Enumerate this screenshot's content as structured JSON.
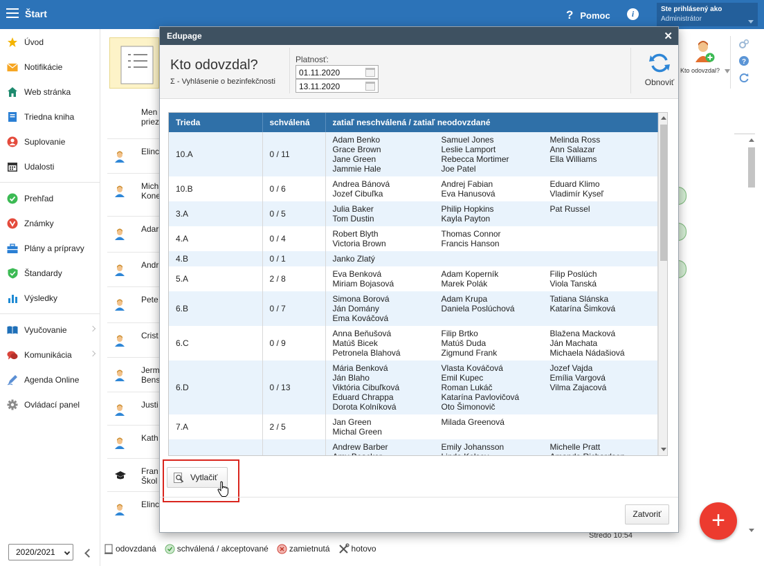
{
  "topbar": {
    "title": "Štart",
    "help_label": "Pomoc",
    "user_line1": "Ste prihlásený ako",
    "user_line2": "Administrátor"
  },
  "sidebar": {
    "items": [
      {
        "label": "Úvod",
        "icon": "star-icon"
      },
      {
        "label": "Notifikácie",
        "icon": "envelope-icon"
      },
      {
        "label": "Web stránka",
        "icon": "home-icon"
      },
      {
        "label": "Triedna kniha",
        "icon": "book-icon"
      },
      {
        "label": "Suplovanie",
        "icon": "person-icon"
      },
      {
        "label": "Udalosti",
        "icon": "calendar-icon"
      },
      {
        "label": "Prehľad",
        "icon": "check-circle-icon"
      },
      {
        "label": "Známky",
        "icon": "grades-icon"
      },
      {
        "label": "Plány a prípravy",
        "icon": "briefcase-icon"
      },
      {
        "label": "Štandardy",
        "icon": "shield-icon"
      },
      {
        "label": "Výsledky",
        "icon": "bar-chart-icon"
      },
      {
        "label": "Vyučovanie",
        "icon": "open-book-icon"
      },
      {
        "label": "Komunikácia",
        "icon": "chat-icon"
      },
      {
        "label": "Agenda Online",
        "icon": "pen-icon"
      },
      {
        "label": "Ovládací panel",
        "icon": "gear-icon"
      }
    ],
    "year": "2020/2021"
  },
  "background": {
    "col_head_l1": "Men",
    "col_head_l2": "priez",
    "rows": [
      {
        "l1": "Elinc",
        "l2": ""
      },
      {
        "l1": "Mich",
        "l2": "Kone"
      },
      {
        "l1": "Adar",
        "l2": ""
      },
      {
        "l1": "Andr",
        "l2": ""
      },
      {
        "l1": "Pete",
        "l2": ""
      },
      {
        "l1": "Crist",
        "l2": ""
      },
      {
        "l1": "Jerm",
        "l2": "Bens"
      },
      {
        "l1": "Justi",
        "l2": ""
      },
      {
        "l1": "Kath",
        "l2": ""
      },
      {
        "l1": "Fran",
        "l2": "Škol"
      },
      {
        "l1": "Elinc",
        "l2": ""
      }
    ],
    "toolbar_label": "Kto odovzdal?",
    "stredo_text": "Stredo 10:54"
  },
  "legend": [
    {
      "label": "odovzdaná",
      "icon": "document-icon"
    },
    {
      "label": "schválená / akceptované",
      "icon": "green-check-icon"
    },
    {
      "label": "zamietnutá",
      "icon": "red-x-icon"
    },
    {
      "label": "hotovo",
      "icon": "tools-icon"
    }
  ],
  "fab_label": "+",
  "modal": {
    "title": "Edupage",
    "heading": "Kto odovzdal?",
    "subtitle": "Σ - Vyhlásenie o bezinfekčnosti",
    "platnost_label": "Platnosť:",
    "date_from": "01.11.2020",
    "date_to": "13.11.2020",
    "refresh_label": "Obnoviť",
    "columns": [
      "Trieda",
      "schválená",
      "zatiaľ neschválená / zatiaľ neodovzdané"
    ],
    "rows": [
      {
        "trieda": "10.A",
        "count": "0 / 11",
        "names": [
          [
            "Adam Benko",
            "Grace Brown",
            "Jane Green",
            "Jammie Hale"
          ],
          [
            "Samuel Jones",
            "Leslie Lamport",
            "Rebecca Mortimer",
            "Joe Patel"
          ],
          [
            "Melinda Ross",
            "Ann Salazar",
            "Ella Williams"
          ]
        ]
      },
      {
        "trieda": "10.B",
        "count": "0 / 6",
        "names": [
          [
            "Andrea Bánová",
            "Jozef Cibuľka"
          ],
          [
            "Andrej Fabian",
            "Eva Hanusová"
          ],
          [
            "Eduard Klimo",
            "Vladimír Kyseľ"
          ]
        ]
      },
      {
        "trieda": "3.A",
        "count": "0 / 5",
        "names": [
          [
            "Julia Baker",
            "Tom Dustin"
          ],
          [
            "Philip Hopkins",
            "Kayla Payton"
          ],
          [
            "Pat Russel"
          ]
        ]
      },
      {
        "trieda": "4.A",
        "count": "0 / 4",
        "names": [
          [
            "Robert Blyth",
            "Victoria Brown"
          ],
          [
            "Thomas Connor",
            "Francis Hanson"
          ],
          []
        ]
      },
      {
        "trieda": "4.B",
        "count": "0 / 1",
        "names": [
          [
            "Janko Zlatý"
          ],
          [],
          []
        ]
      },
      {
        "trieda": "5.A",
        "count": "2 / 8",
        "names": [
          [
            "Eva Benková",
            "Miriam Bojasová"
          ],
          [
            "Adam Koperník",
            "Marek Polák"
          ],
          [
            "Filip Poslúch",
            "Viola Tanská"
          ]
        ]
      },
      {
        "trieda": "6.B",
        "count": "0 / 7",
        "names": [
          [
            "Simona Borová",
            "Ján Domány",
            "Ema Kováčová"
          ],
          [
            "Adam Krupa",
            "Daniela Poslúchová"
          ],
          [
            "Tatiana Slánska",
            "Katarína Šimková"
          ]
        ]
      },
      {
        "trieda": "6.C",
        "count": "0 / 9",
        "names": [
          [
            "Anna Beňušová",
            "Matúš Bicek",
            "Petronela Blahová"
          ],
          [
            "Filip Brtko",
            "Matúš Duda",
            "Zigmund Frank"
          ],
          [
            "Blažena Macková",
            "Ján Machata",
            "Michaela Nádašiová"
          ]
        ]
      },
      {
        "trieda": "6.D",
        "count": "0 / 13",
        "names": [
          [
            "Mária Benková",
            "Ján Blaho",
            "Viktória Cibuľková",
            "Eduard Chrappa",
            "Dorota Kolníková"
          ],
          [
            "Vlasta Kováčová",
            "Emil Kupec",
            "Roman Lukáč",
            "Katarína Pavlovičová",
            "Oto Šimonovič"
          ],
          [
            "Jozef Vajda",
            "Emília Vargová",
            "Vilma Zajacová"
          ]
        ]
      },
      {
        "trieda": "7.A",
        "count": "2 / 5",
        "names": [
          [
            "Jan Green",
            "Michal Green"
          ],
          [
            "Milada Greenová"
          ],
          []
        ]
      },
      {
        "trieda": "",
        "count": "",
        "names": [
          [
            "Andrew Barber",
            "Amy Beacker"
          ],
          [
            "Emily Johansson",
            "Linda Kelsey"
          ],
          [
            "Michelle Pratt",
            "Amanda Richardson"
          ]
        ]
      }
    ],
    "print_label": "Vytlačiť",
    "close_label": "Zatvoriť"
  }
}
